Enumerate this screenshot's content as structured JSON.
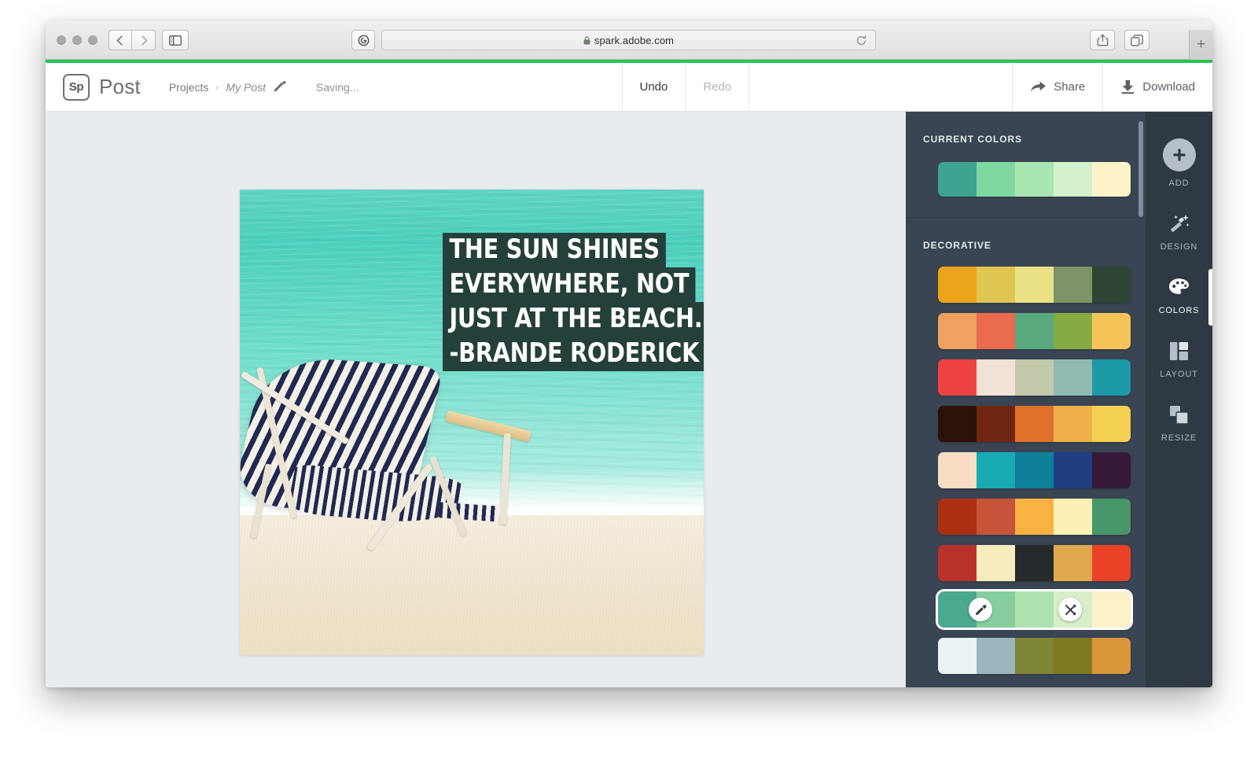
{
  "browser": {
    "url": "spark.adobe.com",
    "lock_icon": "lock-icon",
    "back_icon": "chevron-left-icon",
    "forward_icon": "chevron-right-icon",
    "sidebar_icon": "sidebar-toggle-icon",
    "reader_icon": "reader-view-icon",
    "reload_icon": "reload-icon",
    "share_icon": "share-icon",
    "tabs_icon": "show-tabs-icon",
    "newtab_label": "+"
  },
  "app": {
    "logo_text": "Sp",
    "title": "Post",
    "breadcrumb": {
      "root": "Projects",
      "separator": "›",
      "current": "My Post",
      "edit_icon": "pencil-icon"
    },
    "save_status": "Saving...",
    "undo_label": "Undo",
    "redo_label": "Redo",
    "share_label": "Share",
    "download_label": "Download",
    "share_icon": "share-arrow-icon",
    "download_icon": "download-arrow-icon"
  },
  "canvas": {
    "quote_lines": [
      "THE SUN SHINES",
      "EVERYWHERE, NOT",
      "JUST AT THE BEACH.",
      "-BRANDE RODERICK"
    ],
    "image_description": "beach-chair-on-sand-with-turquoise-sea",
    "text_block_color": "#24403a",
    "text_color": "#ffffff"
  },
  "panel": {
    "current_colors": {
      "title": "CURRENT COLORS",
      "swatches": [
        "#3ea391",
        "#7ed8a0",
        "#a7e6b3",
        "#d4f0cd",
        "#fcf3c8"
      ]
    },
    "decorative": {
      "title": "DECORATIVE",
      "palettes": [
        {
          "selected": false,
          "swatches": [
            "#eda31c",
            "#dfc552",
            "#e8e285",
            "#7e9468",
            "#2f4435"
          ]
        },
        {
          "selected": false,
          "swatches": [
            "#f0a05f",
            "#ea6b4d",
            "#59a87e",
            "#86ab42",
            "#f5c459"
          ]
        },
        {
          "selected": false,
          "swatches": [
            "#ef4243",
            "#f0e3d6",
            "#c5c9ab",
            "#8fbab1",
            "#1d9aa8"
          ]
        },
        {
          "selected": false,
          "swatches": [
            "#2c100a",
            "#702611",
            "#e0712a",
            "#f0b14c",
            "#f3cf52"
          ]
        },
        {
          "selected": false,
          "swatches": [
            "#f6ddc3",
            "#19aab4",
            "#0e8098",
            "#1f3f82",
            "#361938"
          ]
        },
        {
          "selected": false,
          "swatches": [
            "#ab2f12",
            "#c5543a",
            "#f9b142",
            "#fdf0b4",
            "#47976a"
          ]
        },
        {
          "selected": false,
          "swatches": [
            "#b8322b",
            "#f6edbe",
            "#252b2b",
            "#e1a850",
            "#ea4226"
          ]
        },
        {
          "selected": true,
          "swatches": [
            "#4aa98f",
            "#86ce9d",
            "#aee2b0",
            "#d7eec9",
            "#fbf2c9"
          ],
          "eyedropper_icon": "eyedropper-icon",
          "shuffle_icon": "shuffle-icon"
        },
        {
          "selected": false,
          "swatches": [
            "#e9f2f4",
            "#9cb6bf",
            "#7f8536",
            "#7d7a22",
            "#d9973a"
          ]
        }
      ]
    },
    "scrollbar": "panel-scrollbar"
  },
  "tool_rail": {
    "items": [
      {
        "label": "ADD",
        "icon": "plus-circle-icon",
        "active": false
      },
      {
        "label": "DESIGN",
        "icon": "magic-wand-icon",
        "active": false
      },
      {
        "label": "COLORS",
        "icon": "palette-icon",
        "active": true
      },
      {
        "label": "LAYOUT",
        "icon": "layout-grid-icon",
        "active": false
      },
      {
        "label": "RESIZE",
        "icon": "resize-squares-icon",
        "active": false
      }
    ]
  },
  "colors": {
    "load_bar": "#23c552",
    "panel_bg": "#394552",
    "rail_bg": "#2e3944",
    "canvas_bg": "#e9ecee"
  }
}
